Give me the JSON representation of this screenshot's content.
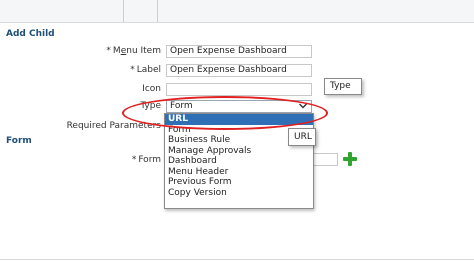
{
  "sections": {
    "add_child": "Add Child",
    "form": "Form"
  },
  "fields": {
    "menu_item": {
      "required": "*",
      "label_pre": "M",
      "label_u": "e",
      "label_post": "nu Item",
      "value": "Open Expense Dashboard"
    },
    "label": {
      "required": "*",
      "label": "Label",
      "value": "Open Expense Dashboard"
    },
    "icon": {
      "label": "Icon",
      "value": ""
    },
    "type": {
      "label": "Type",
      "value": "Form"
    },
    "required_parameters": {
      "label": "Required Parameters"
    },
    "form": {
      "required": "*",
      "label": "Form"
    }
  },
  "type_dropdown": {
    "options": [
      "URL",
      "Form",
      "Business Rule",
      "Manage Approvals",
      "Dashboard",
      "Menu Header",
      "Previous Form",
      "Copy Version"
    ],
    "selected": "URL"
  },
  "tooltips": {
    "type": "Type",
    "url": "URL"
  },
  "icons": {
    "dropdown_chevron": "chevron-down-icon",
    "add_form": "plus-icon"
  },
  "colors": {
    "section_title": "#1f4e79",
    "selected_option": "#2f6fb5",
    "highlight_ellipse": "#e02020",
    "plus_icon": "#2ea52e"
  }
}
